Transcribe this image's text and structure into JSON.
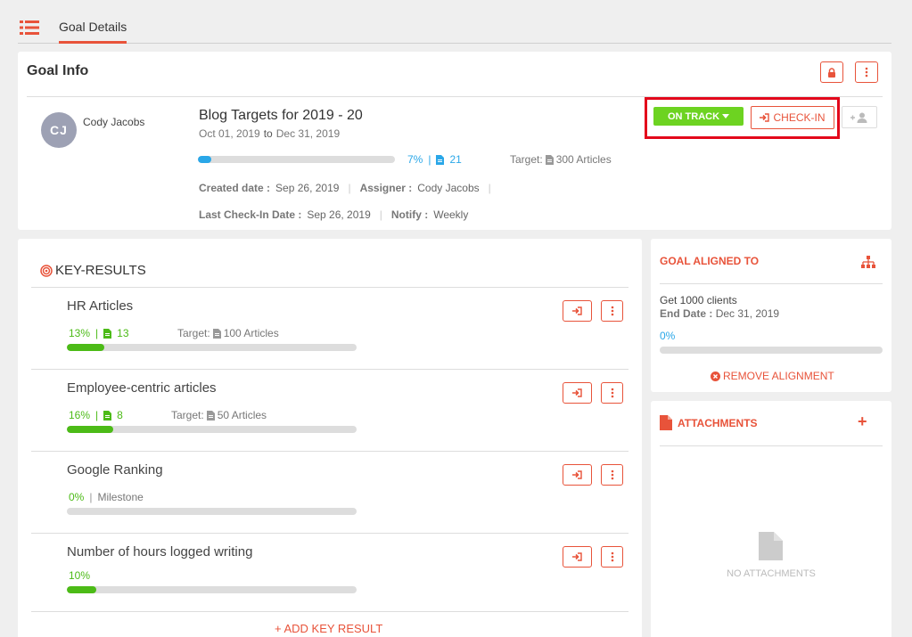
{
  "topbar": {
    "active_tab": "Goal Details"
  },
  "goal": {
    "section_title": "Goal Info",
    "owner_initials": "CJ",
    "owner_name": "Cody Jacobs",
    "title": "Blog Targets for 2019 - 20",
    "start_date": "Oct 01, 2019",
    "to_label": "to",
    "end_date": "Dec 31, 2019",
    "progress_percent_label": "7%",
    "progress_fraction": 0.07,
    "progress_color": "#2aa7e8",
    "count": "21",
    "target_label": "Target:",
    "target_value": "300 Articles",
    "created_label": "Created date :",
    "created_value": "Sep 26, 2019",
    "assigner_label": "Assigner :",
    "assigner_value": "Cody Jacobs",
    "checkin_label": "Last Check-In Date :",
    "checkin_value": "Sep 26, 2019",
    "notify_label": "Notify :",
    "notify_value": "Weekly",
    "status_label": "ON TRACK",
    "status_color": "#6dd321",
    "checkin_button": "CHECK-IN"
  },
  "key_results": {
    "title": "KEY-RESULTS",
    "add_label": "+ ADD KEY RESULT",
    "items": [
      {
        "title": "HR Articles",
        "percent": "13%",
        "fraction": 0.13,
        "count": "13",
        "target_label": "Target:",
        "target_value": "100 Articles"
      },
      {
        "title": "Employee-centric articles",
        "percent": "16%",
        "fraction": 0.16,
        "count": "8",
        "target_label": "Target:",
        "target_value": "50 Articles"
      },
      {
        "title": "Google Ranking",
        "percent": "0%",
        "fraction": 0.0,
        "type_label": "Milestone"
      },
      {
        "title": "Number of hours logged writing",
        "percent": "10%",
        "fraction": 0.1
      }
    ]
  },
  "alignment": {
    "title": "GOAL ALIGNED TO",
    "goal_name": "Get 1000 clients",
    "end_label": "End Date :",
    "end_value": "Dec 31, 2019",
    "percent": "0%",
    "fraction": 0.0,
    "remove_label": "REMOVE ALIGNMENT"
  },
  "attachments": {
    "title": "ATTACHMENTS",
    "empty_label": "NO ATTACHMENTS"
  },
  "colors": {
    "accent": "#e8533a",
    "green": "#4cbb17",
    "blue": "#2aa7e8",
    "highlight": "#e3081b"
  }
}
